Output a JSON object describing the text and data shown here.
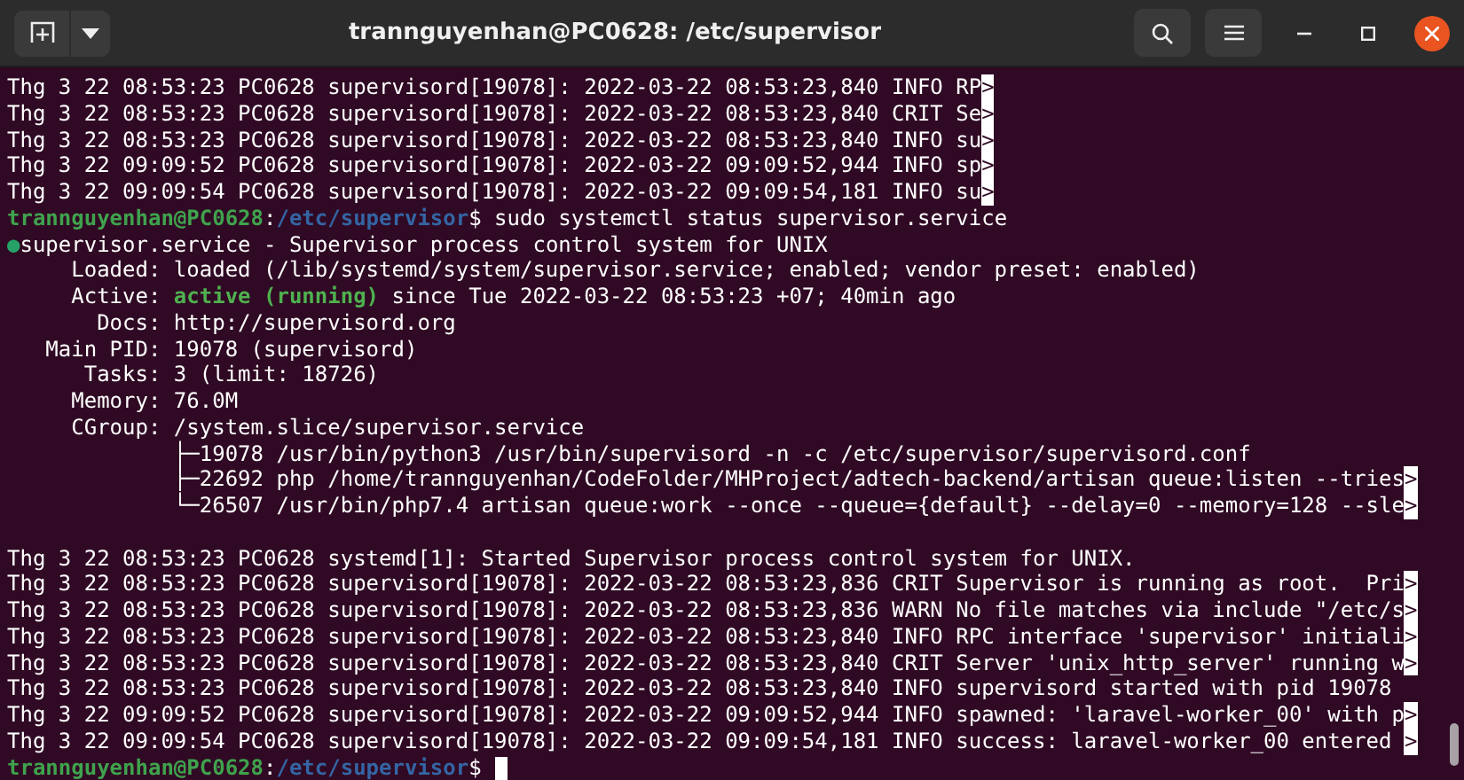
{
  "window": {
    "title": "trannguyenhan@PC0628: /etc/supervisor"
  },
  "terminal": {
    "cursor": true,
    "lines": [
      {
        "kind": "text",
        "segments": [
          {
            "kind": "plain",
            "text": "Thg 3 22 08:53:23 PC0628 supervisord[19078]: 2022-03-22 08:53:23,840 INFO RP"
          },
          {
            "kind": "marker",
            "text": ">"
          }
        ]
      },
      {
        "kind": "text",
        "segments": [
          {
            "kind": "plain",
            "text": "Thg 3 22 08:53:23 PC0628 supervisord[19078]: 2022-03-22 08:53:23,840 CRIT Se"
          },
          {
            "kind": "marker",
            "text": ">"
          }
        ]
      },
      {
        "kind": "text",
        "segments": [
          {
            "kind": "plain",
            "text": "Thg 3 22 08:53:23 PC0628 supervisord[19078]: 2022-03-22 08:53:23,840 INFO su"
          },
          {
            "kind": "marker",
            "text": ">"
          }
        ]
      },
      {
        "kind": "text",
        "segments": [
          {
            "kind": "plain",
            "text": "Thg 3 22 09:09:52 PC0628 supervisord[19078]: 2022-03-22 09:09:52,944 INFO sp"
          },
          {
            "kind": "marker",
            "text": ">"
          }
        ]
      },
      {
        "kind": "text",
        "segments": [
          {
            "kind": "plain",
            "text": "Thg 3 22 09:09:54 PC0628 supervisord[19078]: 2022-03-22 09:09:54,181 INFO su"
          },
          {
            "kind": "marker",
            "text": ">"
          }
        ]
      },
      {
        "kind": "text",
        "segments": [
          {
            "kind": "user",
            "text": "trannguyenhan@PC0628"
          },
          {
            "kind": "plain",
            "text": ":"
          },
          {
            "kind": "path",
            "text": "/etc/supervisor"
          },
          {
            "kind": "plain",
            "text": "$ sudo systemctl status supervisor.service"
          }
        ]
      },
      {
        "kind": "text",
        "segments": [
          {
            "kind": "dot",
            "text": "●"
          },
          {
            "kind": "plain",
            "text": "supervisor.service - Supervisor process control system for UNIX"
          }
        ]
      },
      {
        "kind": "text",
        "segments": [
          {
            "kind": "plain",
            "text": "     Loaded: loaded (/lib/systemd/system/supervisor.service; enabled; vendor preset: enabled)"
          }
        ]
      },
      {
        "kind": "text",
        "segments": [
          {
            "kind": "plain",
            "text": "     Active: "
          },
          {
            "kind": "active",
            "text": "active (running)"
          },
          {
            "kind": "plain",
            "text": " since Tue 2022-03-22 08:53:23 +07; 40min ago"
          }
        ]
      },
      {
        "kind": "text",
        "segments": [
          {
            "kind": "plain",
            "text": "       Docs: http://supervisord.org"
          }
        ]
      },
      {
        "kind": "text",
        "segments": [
          {
            "kind": "plain",
            "text": "   Main PID: 19078 (supervisord)"
          }
        ]
      },
      {
        "kind": "text",
        "segments": [
          {
            "kind": "plain",
            "text": "      Tasks: 3 (limit: 18726)"
          }
        ]
      },
      {
        "kind": "text",
        "segments": [
          {
            "kind": "plain",
            "text": "     Memory: 76.0M"
          }
        ]
      },
      {
        "kind": "text",
        "segments": [
          {
            "kind": "plain",
            "text": "     CGroup: /system.slice/supervisor.service"
          }
        ]
      },
      {
        "kind": "text",
        "segments": [
          {
            "kind": "plain",
            "text": "             ├─19078 /usr/bin/python3 /usr/bin/supervisord -n -c /etc/supervisor/supervisord.conf"
          }
        ]
      },
      {
        "kind": "text",
        "segments": [
          {
            "kind": "plain",
            "text": "             ├─22692 php /home/trannguyenhan/CodeFolder/MHProject/adtech-backend/artisan queue:listen --tries"
          },
          {
            "kind": "marker",
            "text": ">"
          }
        ]
      },
      {
        "kind": "text",
        "segments": [
          {
            "kind": "plain",
            "text": "             └─26507 /usr/bin/php7.4 artisan queue:work --once --queue={default} --delay=0 --memory=128 --sle"
          },
          {
            "kind": "marker",
            "text": ">"
          }
        ]
      },
      {
        "kind": "blank"
      },
      {
        "kind": "text",
        "segments": [
          {
            "kind": "plain",
            "text": "Thg 3 22 08:53:23 PC0628 systemd[1]: Started Supervisor process control system for UNIX."
          }
        ]
      },
      {
        "kind": "text",
        "segments": [
          {
            "kind": "plain",
            "text": "Thg 3 22 08:53:23 PC0628 supervisord[19078]: 2022-03-22 08:53:23,836 CRIT Supervisor is running as root.  Pri"
          },
          {
            "kind": "marker",
            "text": ">"
          }
        ]
      },
      {
        "kind": "text",
        "segments": [
          {
            "kind": "plain",
            "text": "Thg 3 22 08:53:23 PC0628 supervisord[19078]: 2022-03-22 08:53:23,836 WARN No file matches via include \"/etc/s"
          },
          {
            "kind": "marker",
            "text": ">"
          }
        ]
      },
      {
        "kind": "text",
        "segments": [
          {
            "kind": "plain",
            "text": "Thg 3 22 08:53:23 PC0628 supervisord[19078]: 2022-03-22 08:53:23,840 INFO RPC interface 'supervisor' initiali"
          },
          {
            "kind": "marker",
            "text": ">"
          }
        ]
      },
      {
        "kind": "text",
        "segments": [
          {
            "kind": "plain",
            "text": "Thg 3 22 08:53:23 PC0628 supervisord[19078]: 2022-03-22 08:53:23,840 CRIT Server 'unix_http_server' running w"
          },
          {
            "kind": "marker",
            "text": ">"
          }
        ]
      },
      {
        "kind": "text",
        "segments": [
          {
            "kind": "plain",
            "text": "Thg 3 22 08:53:23 PC0628 supervisord[19078]: 2022-03-22 08:53:23,840 INFO supervisord started with pid 19078"
          }
        ]
      },
      {
        "kind": "text",
        "segments": [
          {
            "kind": "plain",
            "text": "Thg 3 22 09:09:52 PC0628 supervisord[19078]: 2022-03-22 09:09:52,944 INFO spawned: 'laravel-worker_00' with p"
          },
          {
            "kind": "marker",
            "text": ">"
          }
        ]
      },
      {
        "kind": "text",
        "segments": [
          {
            "kind": "plain",
            "text": "Thg 3 22 09:09:54 PC0628 supervisord[19078]: 2022-03-22 09:09:54,181 INFO success: laravel-worker_00 entered "
          },
          {
            "kind": "marker",
            "text": ">"
          }
        ]
      },
      {
        "kind": "text",
        "segments": [
          {
            "kind": "user",
            "text": "trannguyenhan@PC0628"
          },
          {
            "kind": "plain",
            "text": ":"
          },
          {
            "kind": "path",
            "text": "/etc/supervisor"
          },
          {
            "kind": "plain",
            "text": "$ "
          }
        ]
      }
    ]
  }
}
